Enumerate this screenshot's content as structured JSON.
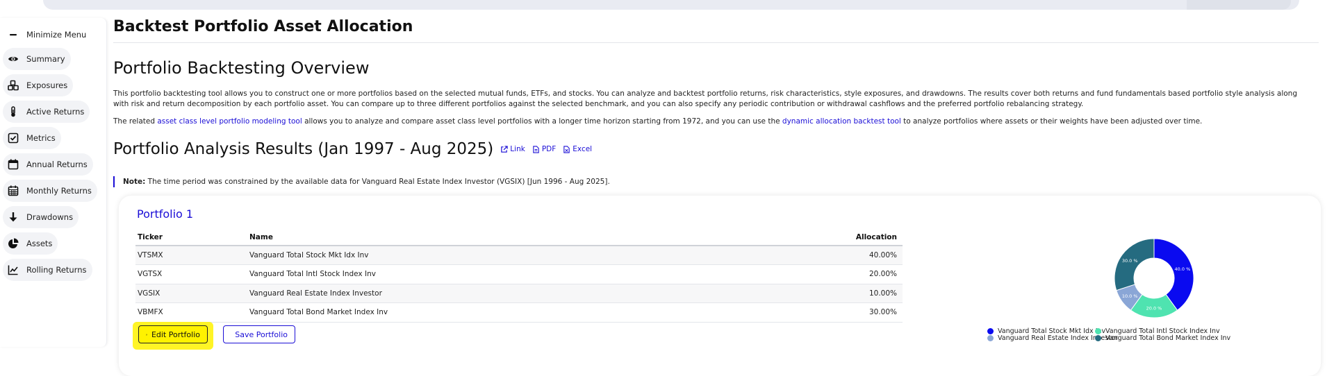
{
  "sidebar": {
    "items": [
      {
        "label": "Minimize Menu",
        "icon": "minus-icon"
      },
      {
        "label": "Summary",
        "icon": "eye-icon"
      },
      {
        "label": "Exposures",
        "icon": "cubes-icon"
      },
      {
        "label": "Active Returns",
        "icon": "thermometer-icon"
      },
      {
        "label": "Metrics",
        "icon": "checkbox-icon"
      },
      {
        "label": "Annual Returns",
        "icon": "calendar-icon"
      },
      {
        "label": "Monthly Returns",
        "icon": "calendar-grid-icon"
      },
      {
        "label": "Drawdowns",
        "icon": "arrow-down-icon"
      },
      {
        "label": "Assets",
        "icon": "pie-icon"
      },
      {
        "label": "Rolling Returns",
        "icon": "line-chart-icon"
      }
    ]
  },
  "page": {
    "title": "Backtest Portfolio Asset Allocation",
    "overview_heading": "Portfolio Backtesting Overview",
    "paragraph1": "This portfolio backtesting tool allows you to construct one or more portfolios based on the selected mutual funds, ETFs, and stocks. You can analyze and backtest portfolio returns, risk characteristics, style exposures, and drawdowns. The results cover both returns and fund fundamentals based portfolio style analysis along with risk and return decomposition by each portfolio asset. You can compare up to three different portfolios against the selected benchmark, and you can also specify any periodic contribution or withdrawal cashflows and the preferred portfolio rebalancing strategy.",
    "paragraph2_pre": "The related ",
    "paragraph2_link1": "asset class level portfolio modeling tool",
    "paragraph2_mid": " allows you to analyze and compare asset class level portfolios with a longer time horizon starting from 1972, and you can use the ",
    "paragraph2_link2": "dynamic allocation backtest tool",
    "paragraph2_post": " to analyze portfolios where assets or their weights have been adjusted over time.",
    "results_heading": "Portfolio Analysis Results (Jan 1997 - Aug 2025)",
    "links": {
      "link": "Link",
      "pdf": "PDF",
      "excel": "Excel"
    },
    "note_label": "Note:",
    "note_text": " The time period was constrained by the available data for Vanguard Real Estate Index Investor (VGSIX) [Jun 1996 - Aug 2025]."
  },
  "portfolio": {
    "title": "Portfolio 1",
    "columns": {
      "ticker": "Ticker",
      "name": "Name",
      "allocation": "Allocation"
    },
    "rows": [
      {
        "ticker": "VTSMX",
        "name": "Vanguard Total Stock Mkt Idx Inv",
        "allocation": "40.00%"
      },
      {
        "ticker": "VGTSX",
        "name": "Vanguard Total Intl Stock Index Inv",
        "allocation": "20.00%"
      },
      {
        "ticker": "VGSIX",
        "name": "Vanguard Real Estate Index Investor",
        "allocation": "10.00%"
      },
      {
        "ticker": "VBMFX",
        "name": "Vanguard Total Bond Market Index Inv",
        "allocation": "30.00%"
      }
    ],
    "edit_label": "Edit Portfolio",
    "save_label": "Save Portfolio"
  },
  "chart_data": {
    "type": "pie",
    "categories": [
      "Vanguard Total Stock Mkt Idx Inv",
      "Vanguard Total Intl Stock Index Inv",
      "Vanguard Real Estate Index Investor",
      "Vanguard Total Bond Market Index Inv"
    ],
    "values": [
      40.0,
      20.0,
      10.0,
      30.0
    ],
    "slice_labels": [
      "40.0 %",
      "20.0 %",
      "10.0 %",
      "30.0 %"
    ],
    "colors": [
      "#0a0af0",
      "#4fe3b0",
      "#8aa6d6",
      "#256b80"
    ],
    "legend": "bottom"
  },
  "colors": {
    "accent": "#1a0dd6",
    "highlight": "#fff200"
  }
}
